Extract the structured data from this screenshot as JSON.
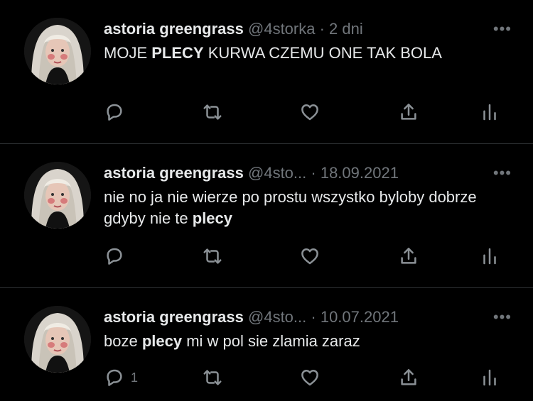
{
  "tweets": [
    {
      "name": "astoria greengrass",
      "handle": "@4storka",
      "dot": "·",
      "time": "2 dni",
      "text_parts": [
        {
          "t": "MOJE ",
          "b": false
        },
        {
          "t": "PLECY",
          "b": true
        },
        {
          "t": " KURWA CZEMU ONE TAK BOLA",
          "b": false
        }
      ],
      "reply_count": ""
    },
    {
      "name": "astoria greengrass",
      "handle": "@4sto...",
      "dot": "·",
      "time": "18.09.2021",
      "text_parts": [
        {
          "t": "nie no ja nie wierze po prostu wszystko byloby dobrze gdyby nie te ",
          "b": false
        },
        {
          "t": "plecy",
          "b": true
        }
      ],
      "reply_count": ""
    },
    {
      "name": "astoria greengrass",
      "handle": "@4sto...",
      "dot": "·",
      "time": "10.07.2021",
      "text_parts": [
        {
          "t": "boze ",
          "b": false
        },
        {
          "t": "plecy",
          "b": true
        },
        {
          "t": " mi w pol sie zlamia zaraz",
          "b": false
        }
      ],
      "reply_count": "1"
    }
  ],
  "more_label": "•••",
  "icons": {
    "reply": "reply-icon",
    "retweet": "retweet-icon",
    "like": "like-icon",
    "share": "share-icon",
    "analytics": "analytics-icon"
  },
  "colors": {
    "background": "#000000",
    "text": "#e7e9ea",
    "muted": "#71767b",
    "divider": "#2f3336"
  }
}
